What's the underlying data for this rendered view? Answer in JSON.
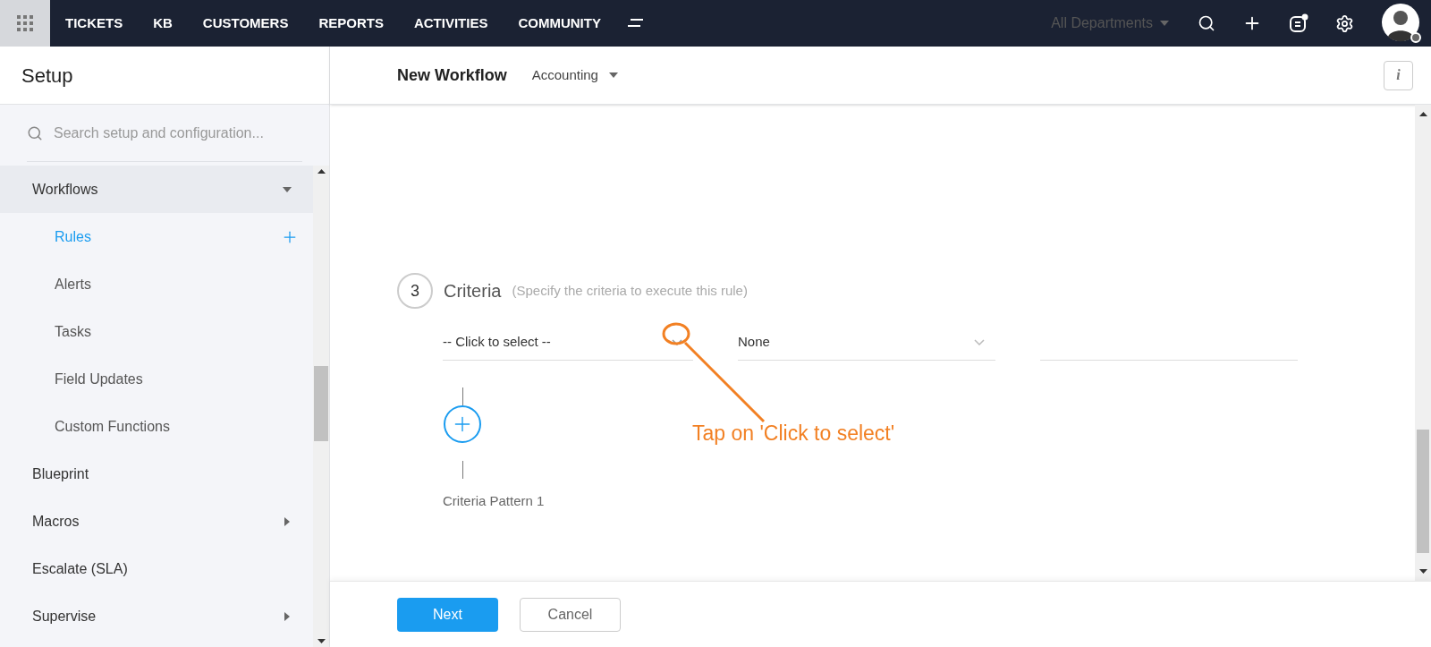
{
  "top_nav": {
    "items": [
      "TICKETS",
      "KB",
      "CUSTOMERS",
      "REPORTS",
      "ACTIVITIES",
      "COMMUNITY"
    ],
    "department": "All Departments"
  },
  "sidebar": {
    "title": "Setup",
    "search": {
      "placeholder": "Search setup and configuration..."
    },
    "items": [
      {
        "label": "Workflows",
        "expanded": true,
        "children": [
          {
            "label": "Rules",
            "selected": true
          },
          {
            "label": "Alerts",
            "selected": false
          },
          {
            "label": "Tasks",
            "selected": false
          },
          {
            "label": "Field Updates",
            "selected": false
          },
          {
            "label": "Custom Functions",
            "selected": false
          }
        ]
      },
      {
        "label": "Blueprint"
      },
      {
        "label": "Macros",
        "expanded": false
      },
      {
        "label": "Escalate (SLA)"
      },
      {
        "label": "Supervise",
        "expanded": false
      }
    ]
  },
  "header": {
    "title": "New Workflow",
    "department": "Accounting",
    "info": "i"
  },
  "criteria": {
    "step": "3",
    "title": "Criteria",
    "hint": "(Specify the criteria to execute this rule)",
    "field": {
      "value": "-- Click to select --"
    },
    "operator": {
      "value": "None"
    },
    "pattern": "Criteria Pattern 1"
  },
  "annotation": {
    "text": "Tap on 'Click to select'"
  },
  "buttons": [
    {
      "label": "Next",
      "kind": "primary"
    },
    {
      "label": "Cancel",
      "kind": "secondary"
    }
  ]
}
